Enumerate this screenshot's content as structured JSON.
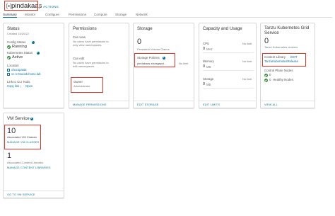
{
  "header": {
    "title": "pindakaas",
    "actions_label": "ACTIONS"
  },
  "tabs": [
    "Summary",
    "Monitor",
    "Configure",
    "Permissions",
    "Compute",
    "Storage",
    "Network"
  ],
  "status_card": {
    "title": "Status",
    "created": "Created 10/20/22",
    "config_status_label": "Config Status",
    "config_status_value": "Running",
    "k8s_status_label": "Kubernetes Status",
    "k8s_status_value": "Active",
    "location_label": "Location",
    "location_1": "chocopasta",
    "location_2": "vc-n-01a.lab.home.lab",
    "cli_label": "Link to CLI Tools",
    "cli_copy": "Copy link",
    "cli_open": "Open"
  },
  "permissions_card": {
    "title": "Permissions",
    "can_view_label": "Can view",
    "can_view_text_1": "No users have permission to",
    "can_view_text_2": "only view namespaces.",
    "can_edit_label": "Can edit",
    "can_edit_text_1": "No users have permission to",
    "can_edit_text_2": "edit namespaces.",
    "owner_label": "Owner",
    "owner_value": "Administrator",
    "manage_link": "MANAGE PERMISSIONS"
  },
  "storage_card": {
    "title": "Storage",
    "claims_count": "0",
    "claims_label": "Persistent Volume Claims",
    "policies_label": "Storage Policies",
    "policy_name": "pindakaas-storagepol...",
    "policy_limit": "No limit",
    "edit_link": "EDIT STORAGE"
  },
  "capacity_card": {
    "title": "Capacity and Usage",
    "cpu_label": "CPU",
    "cpu_value": "0",
    "cpu_unit": "MHz",
    "cpu_limit": "No limit",
    "memory_label": "Memory",
    "memory_value": "0",
    "memory_unit": "MB",
    "memory_limit": "No limit",
    "storage_label": "Storage",
    "storage_value": "0",
    "storage_unit": "MB",
    "storage_limit": "No limit",
    "edit_link": "EDIT LIMITS"
  },
  "tanzu_card": {
    "title_1": "Tanzu Kubernetes Grid",
    "title_2": "Service",
    "clusters_count": "0",
    "clusters_label": "Tanzu Kubernetes clusters",
    "content_library_label": "Content Library",
    "content_library_edit": "EDIT",
    "content_library_value": "TanzuKubernetesRelease",
    "control_plane_label": "Control Plane Nodes",
    "control_plane_value": "0",
    "healthy_label": "Healthy Nodes",
    "healthy_value": "0",
    "view_all": "VIEW ALL"
  },
  "vm_card": {
    "title": "VM Service",
    "vm_classes_count": "10",
    "vm_classes_label": "Associated VM Classes",
    "manage_vm_classes": "MANAGE VM CLASSES",
    "content_libraries_count": "1",
    "content_libraries_label": "Associated Content Libraries",
    "manage_content_libraries": "MANAGE CONTENT LIBRARIES",
    "go_link": "GO TO VM SERVICE"
  },
  "colors": {
    "highlight": "#e4342a",
    "link": "#0072a3",
    "ok": "#2e8a35"
  }
}
